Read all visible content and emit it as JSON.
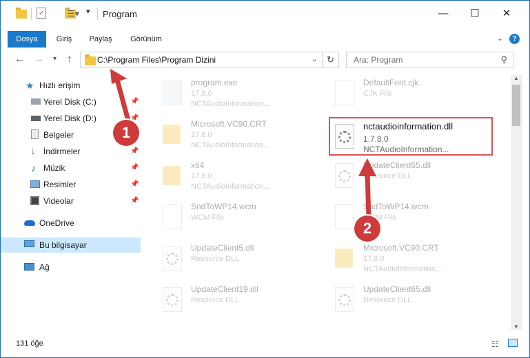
{
  "window": {
    "title": "Program"
  },
  "ribbon": {
    "tabs": [
      "Dosya",
      "Giriş",
      "Paylaş",
      "Görünüm"
    ]
  },
  "address": {
    "path": "C:\\Program Files\\Program Dizini"
  },
  "search": {
    "placeholder": "Ara: Program"
  },
  "nav": {
    "quick_access": "Hızlı erişim",
    "items": [
      {
        "label": "Yerel Disk (C:)",
        "icon": "drive-icon",
        "pinned": true
      },
      {
        "label": "Yerel Disk (D:)",
        "icon": "drive-icon",
        "pinned": true
      },
      {
        "label": "Belgeler",
        "icon": "documents-icon",
        "pinned": true
      },
      {
        "label": "İndirmeler",
        "icon": "downloads-icon",
        "pinned": true
      },
      {
        "label": "Müzik",
        "icon": "music-icon",
        "pinned": true
      },
      {
        "label": "Resimler",
        "icon": "pictures-icon",
        "pinned": true
      },
      {
        "label": "Videolar",
        "icon": "videos-icon",
        "pinned": true
      }
    ],
    "onedrive": "OneDrive",
    "this_pc": "Bu bilgisayar",
    "network": "Ağ"
  },
  "files": [
    {
      "name": "program.exe",
      "line2": "17.8.0",
      "line3": "NCTAudioInformation...",
      "icon": "exe"
    },
    {
      "name": "DefaultFont.cjk",
      "line2": "CJK File",
      "line3": "",
      "icon": "doc"
    },
    {
      "name": "Microsoft.VC90.CRT",
      "line2": "17.8.0",
      "line3": "NCTAudioInformation...",
      "icon": "folder"
    },
    {
      "name": "nctaudioinformation.dll",
      "line2": "1.7.8.0",
      "line3": "NCTAudioInformation...",
      "icon": "dll"
    },
    {
      "name": "x64",
      "line2": "17.8.0",
      "line3": "NCTAudioInformation...",
      "icon": "folder"
    },
    {
      "name": "UpdateClient65.dll",
      "line2": "Resource DLL",
      "line3": "",
      "icon": "dll"
    },
    {
      "name": "SndToWP14.wcm",
      "line2": "WCM File",
      "line3": "",
      "icon": "doc"
    },
    {
      "name": "SndToWP14.wcm",
      "line2": "WCM File",
      "line3": "",
      "icon": "doc"
    },
    {
      "name": "UpdateClient5.dll",
      "line2": "Resource DLL",
      "line3": "",
      "icon": "dll"
    },
    {
      "name": "Microsoft.VC90.CRT",
      "line2": "17.8.0",
      "line3": "NCTAudioInformation...",
      "icon": "folder"
    },
    {
      "name": "UpdateClient19.dll",
      "line2": "Resource DLL",
      "line3": "",
      "icon": "dll"
    },
    {
      "name": "UpdateClient65.dll",
      "line2": "Resource DLL",
      "line3": "",
      "icon": "dll"
    }
  ],
  "status": {
    "count": "131 öğe"
  },
  "annotations": {
    "badge1": "1",
    "badge2": "2",
    "color": "#cf3b3b"
  }
}
